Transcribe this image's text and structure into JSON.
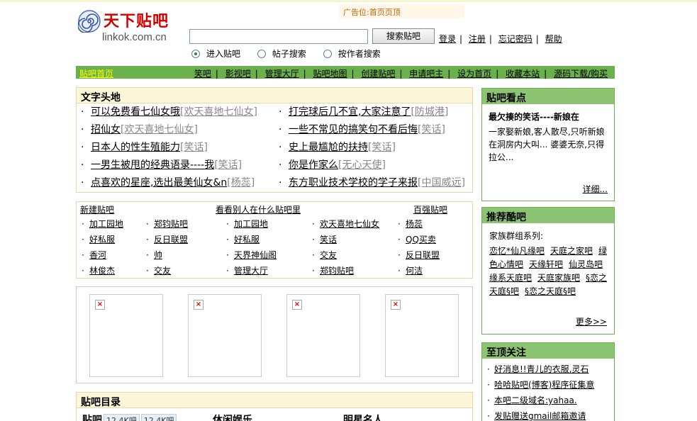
{
  "header": {
    "logo_cn": "天下贴吧",
    "logo_en": "linkok.com.cn",
    "ad_label": "广告位:首页页顶"
  },
  "search": {
    "button": "搜索贴吧",
    "value": "",
    "options": [
      {
        "label": "进入贴吧",
        "checked": true
      },
      {
        "label": "帖子搜索",
        "checked": false
      },
      {
        "label": "按作者搜索",
        "checked": false
      }
    ]
  },
  "user_links": [
    "登录",
    "注册",
    "忘记密码",
    "帮助"
  ],
  "nav": {
    "home": "贴吧首页",
    "links": [
      "笑吧",
      "影视吧",
      "管理大厅",
      "贴吧地图",
      "创建贴吧",
      "申请吧主",
      "设为首页",
      "收藏本站",
      "源码下载/购买"
    ]
  },
  "text_ads": {
    "title": "文字头地",
    "left": [
      {
        "text": "可以免费看七仙女哦",
        "tag": "[欢天喜地七仙女]"
      },
      {
        "text": "招仙女",
        "tag": "[欢天喜地七仙女]"
      },
      {
        "text": "日本人的性生殖能力",
        "tag": "[笑话]"
      },
      {
        "text": "一男生被甩的经典语录----我",
        "tag": "[笑话]"
      },
      {
        "text": "点喜欢的星座,选出最美仙女&n",
        "tag": "[杨蕊]"
      }
    ],
    "right": [
      {
        "text": "打完球后几不宜,大家注意了",
        "tag": "[防城港]"
      },
      {
        "text": "一些不常见的搞笑句不看后悔",
        "tag": "[笑话]"
      },
      {
        "text": "史上最尴尬的扶持",
        "tag": "[笑话]"
      },
      {
        "text": "你是作家么",
        "tag": "[无心天使]"
      },
      {
        "text": "东方职业技术学校的学子来报",
        "tag": "[中国威远]"
      }
    ]
  },
  "new_bars": {
    "heads": [
      "新建贴吧",
      "看看别人在什么贴吧里",
      "百强贴吧"
    ],
    "cols": [
      [
        "加工园地",
        "好私服",
        "香河",
        "林俊杰"
      ],
      [
        "郑钧贴吧",
        "反日联盟",
        "帅",
        "交友"
      ],
      [
        "加工园地",
        "好私服",
        "天界神仙阁",
        "管理大厅"
      ],
      [
        "欢天喜地七仙女",
        "笑话",
        "交友",
        "郑钧贴吧"
      ],
      [
        "杨蕊",
        "QQ买卖",
        "反日联盟",
        "何洁"
      ]
    ]
  },
  "directory": {
    "title": "贴吧目录",
    "row": [
      "贴吧",
      "12.4K吧",
      "12.4K吧",
      "休闲娱乐",
      "明星名人"
    ]
  },
  "featured": {
    "title": "贴吧看点",
    "headline": "最欠揍的笑话----新娘在",
    "body": "一家娶新娘,客人散尽,只听新娘在洞房内大叫... 婆婆无奈,只得拉公...",
    "more": "详细..."
  },
  "recommend": {
    "title": "推荐酷吧",
    "intro": "家族群组系列:",
    "items": [
      "恋忆*仙凡缘吧",
      "天庭之家吧",
      "绿色心情吧",
      "天缘轩吧",
      "仙灵岛吧",
      "缘系天庭吧",
      "天庭家族吧",
      "§恋之天庭§吧",
      "§恋之天庭§吧"
    ],
    "more": "更多>>"
  },
  "attention": {
    "title": "至顶关注",
    "items": [
      "好消息!!青儿的衣服,灵石",
      "哈哈贴吧(博客)程序征集意",
      "本吧二级域名:yahaa.",
      "发贴赠送gmail邮箱邀请"
    ]
  },
  "colors": {
    "nav_green": "#6ab04c",
    "panel_green": "#8dc474",
    "box_cream": "#fdf6d8",
    "nav_home_yellow": "#ffff00"
  },
  "icons": [
    "swirl-logo-icon",
    "broken-image-icon",
    "radio-icon"
  ]
}
